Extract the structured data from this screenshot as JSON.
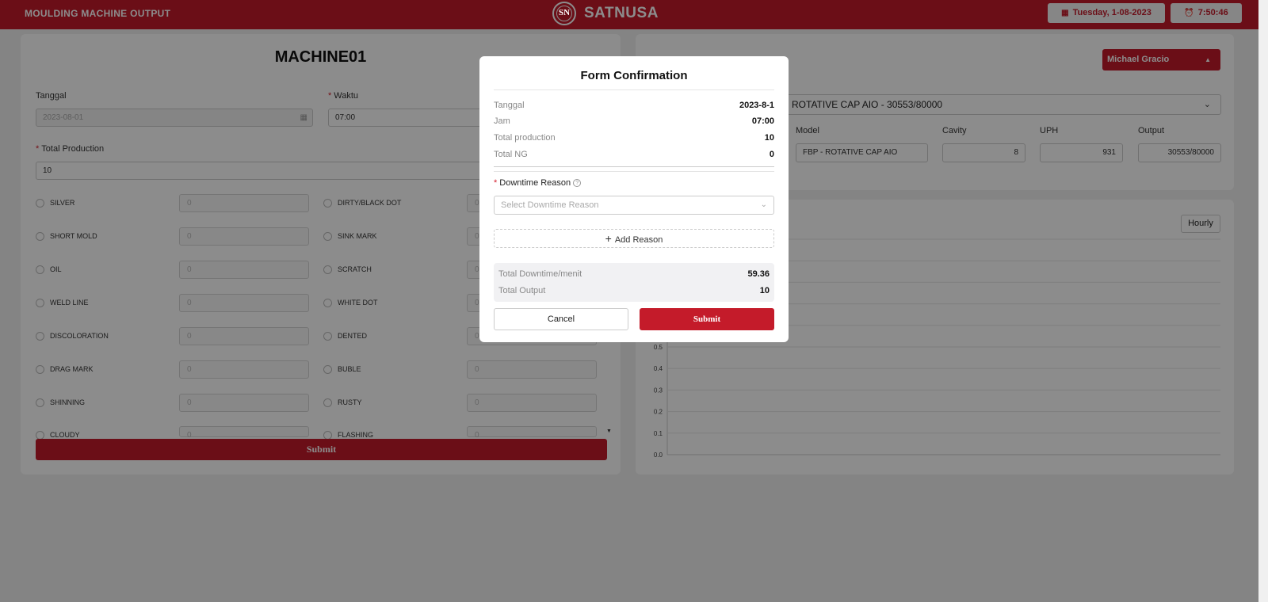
{
  "header": {
    "app_title": "MOULDING MACHINE OUTPUT",
    "logo_letters": "SN",
    "brand": "SATNUSA",
    "date": "Tuesday, 1-08-2023",
    "time": "7:50:46",
    "accent_color": "#c41b2a"
  },
  "left_panel": {
    "machine": "MACHINE01",
    "tanggal_label": "Tanggal",
    "tanggal_value": "2023-08-01",
    "waktu_label": "Waktu",
    "waktu_value": "07:00",
    "total_production_label": "Total Production",
    "total_production_value": "10",
    "defects_col1": [
      {
        "label": "SILVER",
        "value": "0"
      },
      {
        "label": "SHORT MOLD",
        "value": "0"
      },
      {
        "label": "OIL",
        "value": "0"
      },
      {
        "label": "WELD LINE",
        "value": "0"
      },
      {
        "label": "DISCOLORATION",
        "value": "0"
      },
      {
        "label": "DRAG MARK",
        "value": "0"
      },
      {
        "label": "SHINNING",
        "value": "0"
      },
      {
        "label": "CLOUDY",
        "value": "0"
      }
    ],
    "defects_col2": [
      {
        "label": "DIRTY/BLACK DOT",
        "value": "0"
      },
      {
        "label": "SINK MARK",
        "value": "0"
      },
      {
        "label": "SCRATCH",
        "value": "0"
      },
      {
        "label": "WHITE DOT",
        "value": "0"
      },
      {
        "label": "DENTED",
        "value": "0"
      },
      {
        "label": "BUBLE",
        "value": "0"
      },
      {
        "label": "RUSTY",
        "value": "0"
      },
      {
        "label": "FLASHING",
        "value": "0"
      }
    ],
    "submit_label": "Submit"
  },
  "right_panel": {
    "user": "Michael Gracio",
    "product": "ROTATIVE CAP AIO - 30553/80000",
    "fields": [
      {
        "label": "Model",
        "value": "FBP - ROTATIVE CAP AIO"
      },
      {
        "label": "Cavity",
        "value": "8"
      },
      {
        "label": "UPH",
        "value": "931"
      },
      {
        "label": "Output",
        "value": "30553/80000"
      }
    ],
    "hourly_label": "Hourly"
  },
  "chart_data": {
    "type": "line",
    "yticks": [
      "0.0",
      "0.1",
      "0.2",
      "0.3",
      "0.4",
      "0.5"
    ],
    "ylim": [
      0,
      1
    ],
    "series": []
  },
  "modal": {
    "title": "Form Confirmation",
    "rows": [
      {
        "key": "Tanggal",
        "value": "2023-8-1"
      },
      {
        "key": "Jam",
        "value": "07:00"
      },
      {
        "key": "Total production",
        "value": "10"
      },
      {
        "key": "Total NG",
        "value": "0"
      }
    ],
    "reason_label": "Downtime Reason",
    "reason_placeholder": "Select Downtime Reason",
    "add_reason": "Add Reason",
    "summary": [
      {
        "key": "Total Downtime/menit",
        "value": "59.36"
      },
      {
        "key": "Total Output",
        "value": "10"
      }
    ],
    "cancel": "Cancel",
    "submit": "Submit"
  }
}
